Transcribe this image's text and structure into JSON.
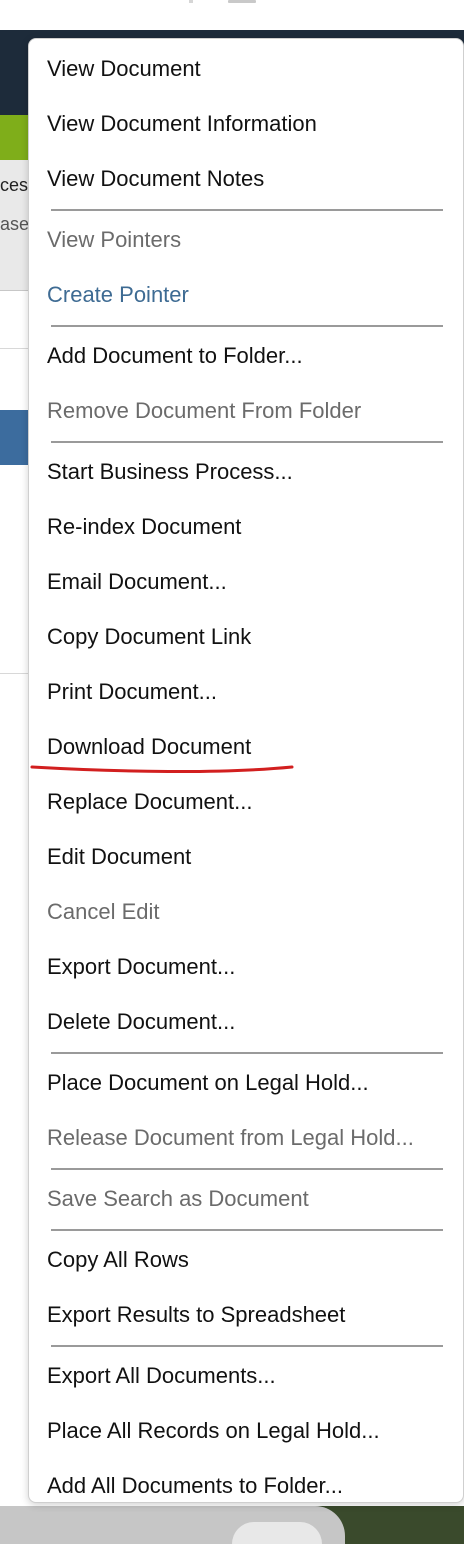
{
  "background": {
    "clipped_texts": [
      "ces",
      "ase"
    ]
  },
  "menu": {
    "sections": [
      {
        "items": [
          {
            "label": "View Document",
            "state": "enabled"
          },
          {
            "label": "View Document Information",
            "state": "enabled"
          },
          {
            "label": "View Document Notes",
            "state": "enabled"
          }
        ]
      },
      {
        "items": [
          {
            "label": "View Pointers",
            "state": "disabled"
          },
          {
            "label": "Create Pointer",
            "state": "link"
          }
        ]
      },
      {
        "items": [
          {
            "label": "Add Document to Folder...",
            "state": "enabled"
          },
          {
            "label": "Remove Document From Folder",
            "state": "disabled"
          }
        ]
      },
      {
        "items": [
          {
            "label": "Start Business Process...",
            "state": "enabled"
          },
          {
            "label": "Re-index Document",
            "state": "enabled"
          },
          {
            "label": "Email Document...",
            "state": "enabled"
          },
          {
            "label": "Copy Document Link",
            "state": "enabled"
          },
          {
            "label": "Print Document...",
            "state": "enabled"
          },
          {
            "label": "Download Document",
            "state": "enabled",
            "annotated": true
          },
          {
            "label": "Replace Document...",
            "state": "enabled"
          },
          {
            "label": "Edit Document",
            "state": "enabled"
          },
          {
            "label": "Cancel Edit",
            "state": "disabled"
          },
          {
            "label": "Export Document...",
            "state": "enabled"
          },
          {
            "label": "Delete Document...",
            "state": "enabled"
          }
        ]
      },
      {
        "items": [
          {
            "label": "Place Document on Legal Hold...",
            "state": "enabled"
          },
          {
            "label": "Release Document from Legal Hold...",
            "state": "disabled"
          }
        ]
      },
      {
        "items": [
          {
            "label": "Save Search as Document",
            "state": "disabled"
          }
        ]
      },
      {
        "items": [
          {
            "label": "Copy All Rows",
            "state": "enabled"
          },
          {
            "label": "Export Results to Spreadsheet",
            "state": "enabled"
          }
        ]
      },
      {
        "items": [
          {
            "label": "Export All Documents...",
            "state": "enabled"
          },
          {
            "label": "Place All Records on Legal Hold...",
            "state": "enabled"
          },
          {
            "label": "Add All Documents to Folder...",
            "state": "enabled"
          }
        ]
      }
    ],
    "annotation_color": "#d21f1f",
    "colors": {
      "enabled": "#111111",
      "disabled": "#6b6b6b",
      "link": "#3e6b93"
    }
  }
}
